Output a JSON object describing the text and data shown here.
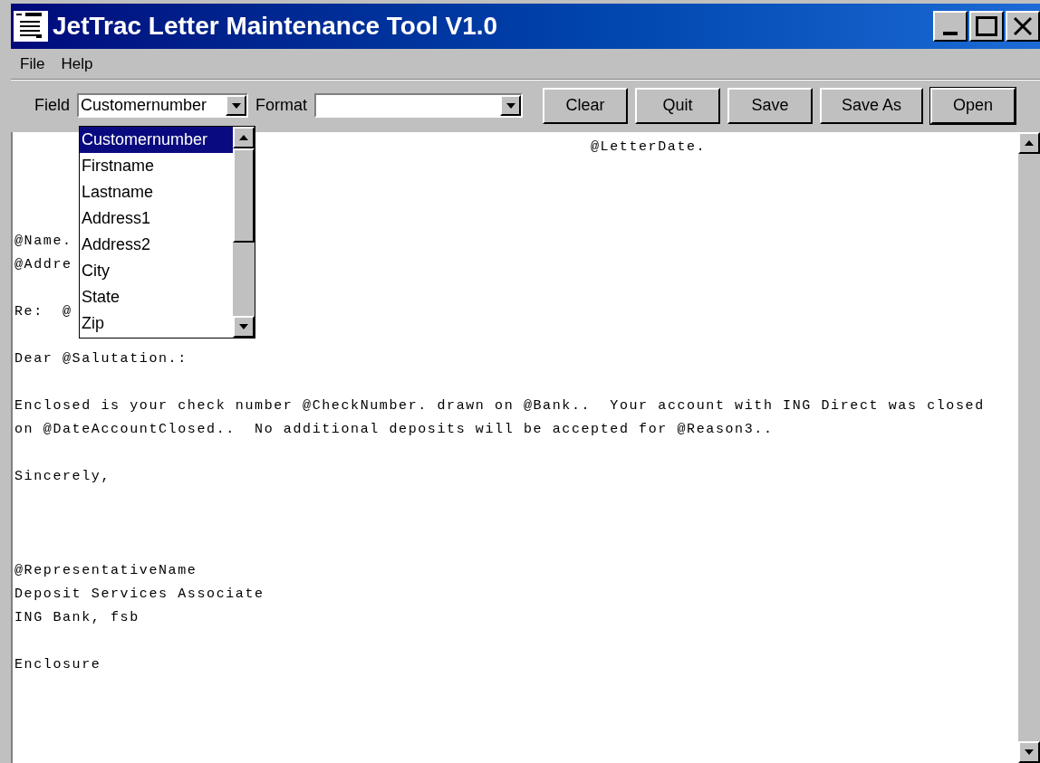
{
  "window": {
    "title": "JetTrac Letter Maintenance Tool V1.0"
  },
  "menu": [
    "File",
    "Help"
  ],
  "toolbar": {
    "field_label": "Field",
    "field_value": "Customernumber",
    "format_label": "Format",
    "buttons": [
      {
        "label": "Clear",
        "default": false
      },
      {
        "label": "Quit",
        "default": false
      },
      {
        "label": "Save",
        "default": false
      },
      {
        "label": "Save As",
        "default": false
      },
      {
        "label": "Open",
        "default": true
      }
    ]
  },
  "dropdown": {
    "items": [
      {
        "label": "Customernumber",
        "selected": true
      },
      {
        "label": "Firstname",
        "selected": false
      },
      {
        "label": "Lastname",
        "selected": false
      },
      {
        "label": "Address1",
        "selected": false
      },
      {
        "label": "Address2",
        "selected": false
      },
      {
        "label": "City",
        "selected": false
      },
      {
        "label": "State",
        "selected": false
      },
      {
        "label": "Zip",
        "selected": false
      }
    ]
  },
  "letter": {
    "lines": [
      {
        "kind": "date",
        "text": "@LetterDate."
      },
      {
        "kind": "blank"
      },
      {
        "kind": "blank"
      },
      {
        "kind": "blank"
      },
      {
        "kind": "text",
        "text": "@Name."
      },
      {
        "kind": "text",
        "text": "@Addre"
      },
      {
        "kind": "blank"
      },
      {
        "kind": "text",
        "text": "Re:  @"
      },
      {
        "kind": "blank"
      },
      {
        "kind": "text",
        "text": "Dear @Salutation.:"
      },
      {
        "kind": "blank"
      },
      {
        "kind": "text",
        "text": "Enclosed is your check number @CheckNumber. drawn on @Bank..  Your account with ING Direct was closed"
      },
      {
        "kind": "text",
        "text": "on @DateAccountClosed..  No additional deposits will be accepted for @Reason3.."
      },
      {
        "kind": "blank"
      },
      {
        "kind": "text",
        "text": "Sincerely,"
      },
      {
        "kind": "blank"
      },
      {
        "kind": "blank"
      },
      {
        "kind": "blank"
      },
      {
        "kind": "text",
        "text": "@RepresentativeName"
      },
      {
        "kind": "text",
        "text": "Deposit Services Associate"
      },
      {
        "kind": "text",
        "text": "ING Bank, fsb"
      },
      {
        "kind": "blank"
      },
      {
        "kind": "text",
        "text": "Enclosure"
      }
    ]
  }
}
